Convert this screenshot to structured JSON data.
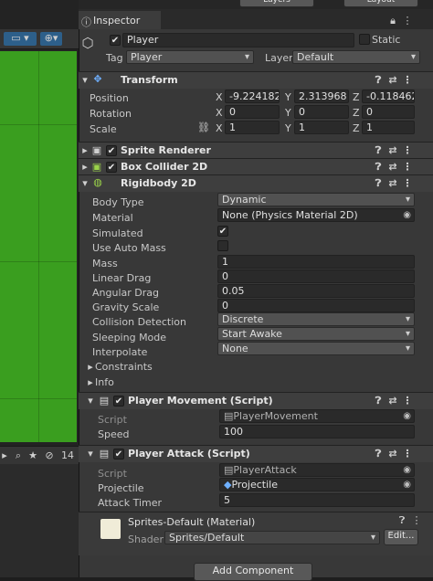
{
  "window": {
    "tab_title": "Inspector"
  },
  "header": {
    "object_name": "Player",
    "static_label": "Static",
    "tag_label": "Tag",
    "tag_value": "Player",
    "layer_label": "Layer",
    "layer_value": "Default"
  },
  "transform": {
    "title": "Transform",
    "position_label": "Position",
    "rotation_label": "Rotation",
    "scale_label": "Scale",
    "x": "X",
    "y": "Y",
    "z": "Z",
    "position": {
      "x": "-9.224182",
      "y": "2.313968",
      "z": "-0.1184623"
    },
    "rotation": {
      "x": "0",
      "y": "0",
      "z": "0"
    },
    "scale": {
      "x": "1",
      "y": "1",
      "z": "1"
    }
  },
  "sprite_renderer": {
    "title": "Sprite Renderer"
  },
  "box_collider": {
    "title": "Box Collider 2D"
  },
  "rigidbody": {
    "title": "Rigidbody 2D",
    "body_type_label": "Body Type",
    "body_type": "Dynamic",
    "material_label": "Material",
    "material": "None (Physics Material 2D)",
    "simulated_label": "Simulated",
    "use_auto_mass_label": "Use Auto Mass",
    "mass_label": "Mass",
    "mass": "1",
    "linear_drag_label": "Linear Drag",
    "linear_drag": "0",
    "angular_drag_label": "Angular Drag",
    "angular_drag": "0.05",
    "gravity_scale_label": "Gravity Scale",
    "gravity_scale": "0",
    "collision_detection_label": "Collision Detection",
    "collision_detection": "Discrete",
    "sleeping_mode_label": "Sleeping Mode",
    "sleeping_mode": "Start Awake",
    "interpolate_label": "Interpolate",
    "interpolate": "None",
    "constraints_label": "Constraints",
    "info_label": "Info"
  },
  "player_movement": {
    "title": "Player Movement (Script)",
    "script_label": "Script",
    "script": "PlayerMovement",
    "speed_label": "Speed",
    "speed": "100"
  },
  "player_attack": {
    "title": "Player Attack (Script)",
    "script_label": "Script",
    "script": "PlayerAttack",
    "projectile_label": "Projectile",
    "projectile": "Projectile",
    "attack_timer_label": "Attack Timer",
    "attack_timer": "5"
  },
  "material": {
    "title": "Sprites-Default (Material)",
    "shader_label": "Shader",
    "shader": "Sprites/Default",
    "edit_label": "Edit..."
  },
  "footer": {
    "add_component": "Add Component"
  },
  "left_panel": {
    "layer_count": "14"
  },
  "top_buttons": {
    "layers": "Layers",
    "layout": "Layout"
  }
}
